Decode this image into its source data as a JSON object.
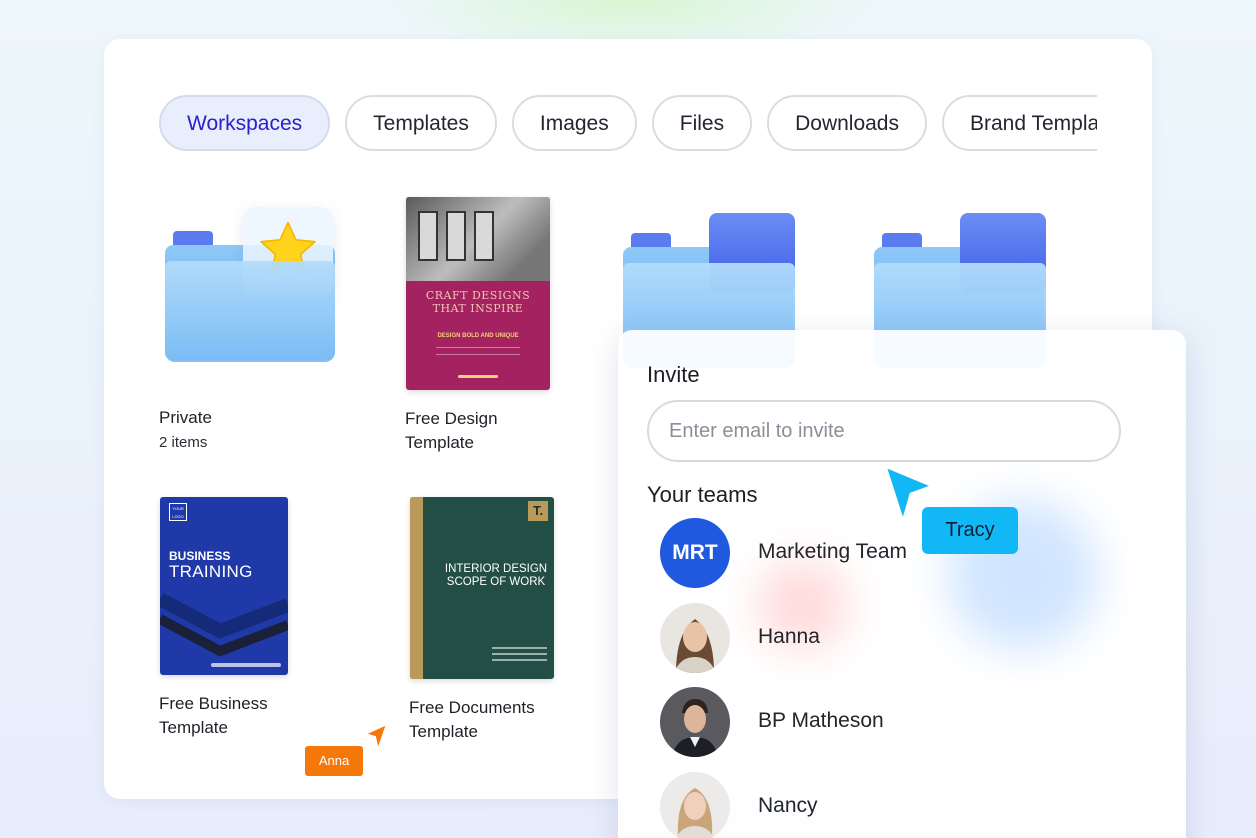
{
  "tabs": [
    {
      "label": "Workspaces",
      "active": true
    },
    {
      "label": "Templates",
      "active": false
    },
    {
      "label": "Images",
      "active": false
    },
    {
      "label": "Files",
      "active": false
    },
    {
      "label": "Downloads",
      "active": false
    },
    {
      "label": "Brand Templates",
      "active": false
    }
  ],
  "items": {
    "private": {
      "name": "Private",
      "count": "2 items",
      "icon": "star-icon"
    },
    "free_design": {
      "name": "Free Design Template",
      "thumb": {
        "headline": "CRAFT DESIGNS THAT INSPIRE",
        "tagline": "DESIGN BOLD AND UNIQUE"
      }
    },
    "free_business": {
      "name": "Free Business Template",
      "thumb": {
        "logo": "YOUR LOGO",
        "line1": "BUSINESS",
        "line2": "TRAINING"
      }
    },
    "free_documents": {
      "name": "Free Documents Template",
      "thumb": {
        "badge": "T.",
        "title": "INTERIOR DESIGN SCOPE OF WORK"
      }
    }
  },
  "invite": {
    "title": "Invite",
    "email_placeholder": "Enter email to invite",
    "teams_heading": "Your teams",
    "members": [
      {
        "name": "Marketing Team",
        "initials": "MRT"
      },
      {
        "name": "Hanna"
      },
      {
        "name": "BP Matheson"
      },
      {
        "name": "Nancy"
      }
    ]
  },
  "cursors": {
    "anna": {
      "label": "Anna",
      "color": "#f5780a"
    },
    "tracy": {
      "label": "Tracy",
      "color": "#12b8f5"
    }
  },
  "colors": {
    "accent": "#2a21c9",
    "team_avatar": "#1f59e0"
  }
}
